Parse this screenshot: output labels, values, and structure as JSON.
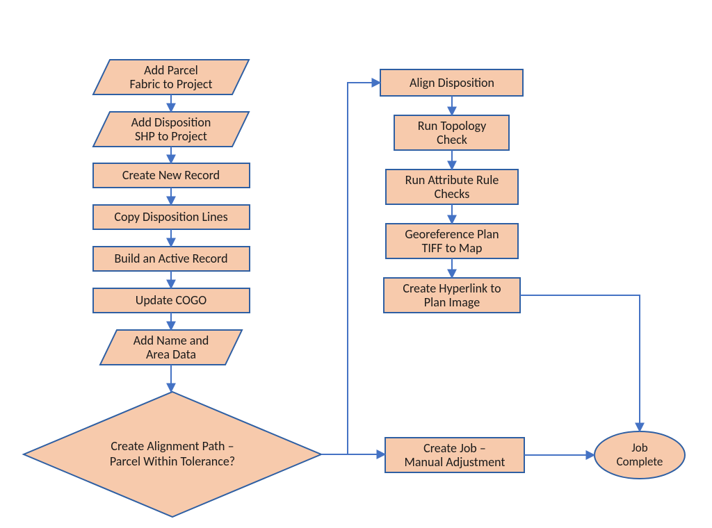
{
  "nodes": {
    "add_parcel_l1": "Add Parcel",
    "add_parcel_l2": "Fabric to Project",
    "add_disp_l1": "Add Disposition",
    "add_disp_l2": "SHP to Project",
    "create_record": "Create New Record",
    "copy_lines": "Copy Disposition Lines",
    "build_active": "Build an Active Record",
    "update_cogo": "Update COGO",
    "add_name_l1": "Add Name and",
    "add_name_l2": "Area Data",
    "decision_l1": "Create Alignment Path –",
    "decision_l2": "Parcel Within Tolerance?",
    "align": "Align Disposition",
    "topo_l1": "Run Topology",
    "topo_l2": "Check",
    "attr_l1": "Run Attribute Rule",
    "attr_l2": "Checks",
    "georef_l1": "Georeference Plan",
    "georef_l2": "TIFF to Map",
    "hyper_l1": "Create Hyperlink to",
    "hyper_l2": "Plan Image",
    "job_l1": "Create Job –",
    "job_l2": "Manual Adjustment",
    "done_l1": "Job",
    "done_l2": "Complete"
  },
  "chart_data": {
    "type": "flowchart",
    "title": "",
    "nodes": [
      {
        "id": "add_parcel",
        "shape": "parallelogram",
        "label": "Add Parcel Fabric to Project"
      },
      {
        "id": "add_disp",
        "shape": "parallelogram",
        "label": "Add Disposition SHP to Project"
      },
      {
        "id": "create_record",
        "shape": "process",
        "label": "Create New Record"
      },
      {
        "id": "copy_lines",
        "shape": "process",
        "label": "Copy Disposition Lines"
      },
      {
        "id": "build_active",
        "shape": "process",
        "label": "Build an Active Record"
      },
      {
        "id": "update_cogo",
        "shape": "process",
        "label": "Update COGO"
      },
      {
        "id": "add_name",
        "shape": "parallelogram",
        "label": "Add Name and Area Data"
      },
      {
        "id": "decision",
        "shape": "decision",
        "label": "Create Alignment Path – Parcel Within Tolerance?"
      },
      {
        "id": "align",
        "shape": "process",
        "label": "Align Disposition"
      },
      {
        "id": "topo",
        "shape": "process",
        "label": "Run Topology Check"
      },
      {
        "id": "attr",
        "shape": "process",
        "label": "Run Attribute Rule Checks"
      },
      {
        "id": "georef",
        "shape": "process",
        "label": "Georeference Plan TIFF to Map"
      },
      {
        "id": "hyper",
        "shape": "process",
        "label": "Create Hyperlink to Plan Image"
      },
      {
        "id": "job",
        "shape": "process",
        "label": "Create Job – Manual Adjustment"
      },
      {
        "id": "done",
        "shape": "terminator",
        "label": "Job Complete"
      }
    ],
    "edges": [
      {
        "from": "add_parcel",
        "to": "add_disp"
      },
      {
        "from": "add_disp",
        "to": "create_record"
      },
      {
        "from": "create_record",
        "to": "copy_lines"
      },
      {
        "from": "copy_lines",
        "to": "build_active"
      },
      {
        "from": "build_active",
        "to": "update_cogo"
      },
      {
        "from": "update_cogo",
        "to": "add_name"
      },
      {
        "from": "add_name",
        "to": "decision"
      },
      {
        "from": "decision",
        "to": "job"
      },
      {
        "from": "decision",
        "to": "align"
      },
      {
        "from": "align",
        "to": "topo"
      },
      {
        "from": "topo",
        "to": "attr"
      },
      {
        "from": "attr",
        "to": "georef"
      },
      {
        "from": "georef",
        "to": "hyper"
      },
      {
        "from": "hyper",
        "to": "done"
      },
      {
        "from": "job",
        "to": "done"
      }
    ]
  },
  "colors": {
    "node_fill": "#f7caac",
    "node_stroke": "#2e5fa3",
    "connector": "#4472c4"
  }
}
